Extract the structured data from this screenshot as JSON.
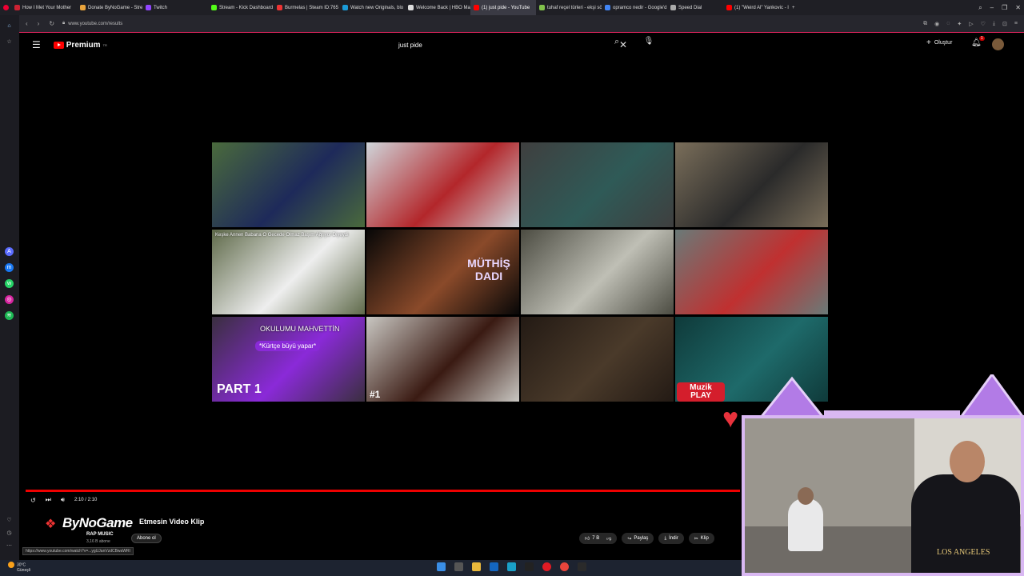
{
  "browser": {
    "tabs": [
      {
        "label": "How I Met Your Mother",
        "color": "#c23"
      },
      {
        "label": "Donate ByNoGame - Stre",
        "color": "#e8a33c"
      },
      {
        "label": "Twitch",
        "color": "#9146ff"
      },
      {
        "label": "Stream - Kick Dashboard",
        "color": "#53fc18"
      },
      {
        "label": "Burmelas | Steam ID:765",
        "color": "#e33"
      },
      {
        "label": "Watch new Originals, blo",
        "color": "#1a9ad6"
      },
      {
        "label": "Welcome Back | HBO Max",
        "color": "#ddd"
      },
      {
        "label": "(1) just pide - YouTube",
        "color": "#f00"
      },
      {
        "label": "tuhaf reçel türleri - ekşi sö",
        "color": "#81c14b"
      },
      {
        "label": "opramco nedir - Google'd",
        "color": "#4285f4"
      },
      {
        "label": "Speed Dial",
        "color": "#aaa"
      },
      {
        "label": "(1) \"Weird Al\" Yankovic - I",
        "color": "#f00"
      }
    ],
    "url": "www.youtube.com/results"
  },
  "youtube": {
    "logo_text": "Premium",
    "logo_sup": "TR",
    "search_value": "just pide",
    "create_label": "Oluştur",
    "notif_count": "1"
  },
  "thumbs": [
    {
      "cap": "",
      "sub": "",
      "bg": "#4a6a3c",
      "accent": "#1e2a5a"
    },
    {
      "cap": "",
      "sub": "",
      "bg": "#cfd5da",
      "accent": "#b3262a"
    },
    {
      "cap": "",
      "sub": "",
      "bg": "#3f3f3f",
      "accent": "#2f5a57"
    },
    {
      "cap": "",
      "sub": "",
      "bg": "#7a6e5a",
      "accent": "#2a2a2a"
    },
    {
      "cap": "Keşke Annen Babana O Gecede Olmaz Başım Ağrıyor Diyeydi",
      "sub": "",
      "bg": "#5f6a4a",
      "accent": "#eeeeee"
    },
    {
      "cap": "",
      "sub": "",
      "bg": "#070707",
      "accent": "#8a4a2a",
      "big": "MÜTHİŞ DADI"
    },
    {
      "cap": "",
      "sub": "",
      "bg": "#4c4c42",
      "accent": "#bfbfb5"
    },
    {
      "cap": "",
      "sub": "",
      "bg": "#6a7a78",
      "accent": "#c03030"
    },
    {
      "cap": "OKULUMU MAHVETTİN",
      "sub": "",
      "bg": "#3a2f3f",
      "accent": "#8a2ad8",
      "big": "PART 1",
      "pill": "*Kürtçe büyü yapar*"
    },
    {
      "cap": "",
      "sub": "",
      "bg": "#c9c7c2",
      "accent": "#3a1a12",
      "big": "#1"
    },
    {
      "cap": "",
      "sub": "",
      "bg": "#231a14",
      "accent": "#4a3a2a"
    },
    {
      "cap": "",
      "sub": "",
      "bg": "#0f3a3a",
      "accent": "#1e6a6a",
      "big": "Muzik PLAY"
    }
  ],
  "player": {
    "time": "2:10 / 2:10",
    "channel_name": "ByNoGame",
    "video_title": "Etmesin Video Klip",
    "channel_sub": "RAP MUSIC",
    "subs_count": "3,16 B abone",
    "subscribe": "Abone ol",
    "likes": "7 B",
    "share": "Paylaş",
    "download": "İndir",
    "clip": "Klip"
  },
  "status_url": "https://www.youtube.com/watch?v=...ygUJanVzdCBwaWRl",
  "weather": {
    "temp": "30°C",
    "desc": "Güneşli"
  },
  "overlay": {
    "shirt_text": "LOS ANGELES"
  }
}
